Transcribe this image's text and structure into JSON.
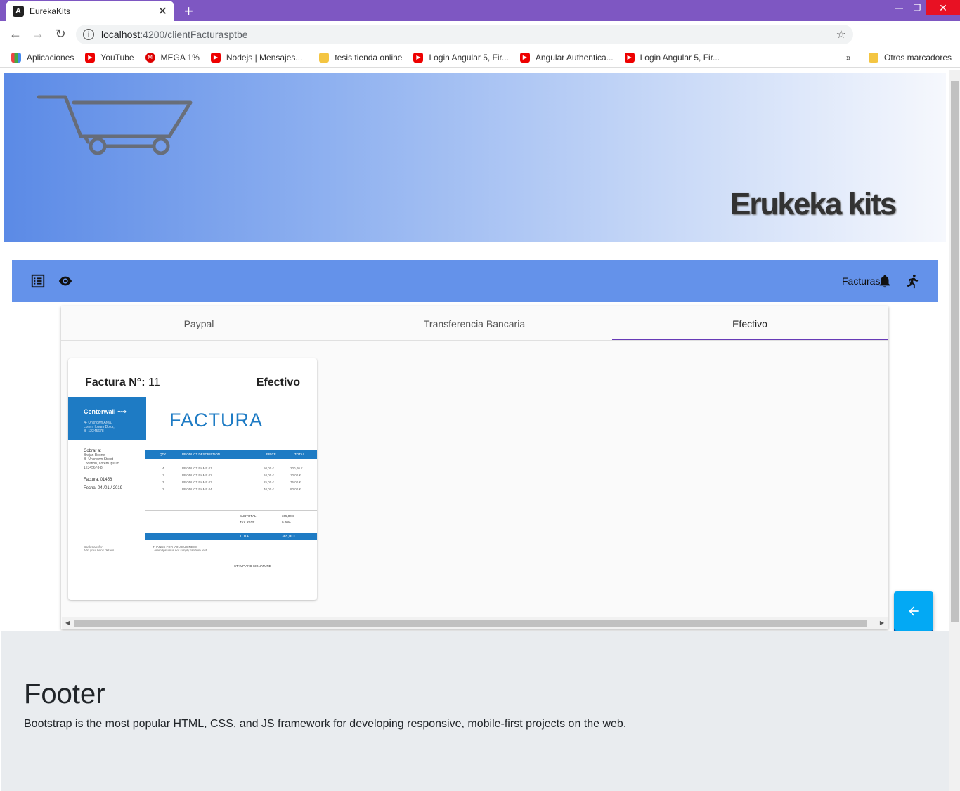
{
  "browser": {
    "tab_title": "EurekaKits",
    "tab_favicon": "A",
    "url_host": "localhost",
    "url_path": ":4200/clientFacturasptbe",
    "bookmarks": [
      {
        "label": "Aplicaciones",
        "icon": "apps-icon"
      },
      {
        "label": "YouTube",
        "icon": "youtube-icon"
      },
      {
        "label": "MEGA 1%",
        "icon": "mega-icon"
      },
      {
        "label": "Nodejs | Mensajes...",
        "icon": "youtube-icon"
      },
      {
        "label": "tesis tienda online",
        "icon": "folder-icon"
      },
      {
        "label": "Login Angular 5, Fir...",
        "icon": "youtube-icon"
      },
      {
        "label": "Angular Authentica...",
        "icon": "youtube-icon"
      },
      {
        "label": "Login Angular 5, Fir...",
        "icon": "youtube-icon"
      }
    ],
    "other_bookmarks": "Otros marcadores",
    "overflow": "»"
  },
  "banner": {
    "brand": "Erukeka kits"
  },
  "toolbar": {
    "label": "Facturas"
  },
  "tabs": [
    {
      "label": "Paypal"
    },
    {
      "label": "Transferencia Bancaria"
    },
    {
      "label": "Efectivo"
    }
  ],
  "invoice": {
    "title": "Factura N°:",
    "number": "11",
    "method": "Efectivo",
    "doc": {
      "company": "Centerwall",
      "company_address": [
        "A- Unknown Area,",
        "Lorem Ipsum Dolor,",
        "B- 12345678"
      ],
      "heading": "FACTURA",
      "bill_to_label": "Cobrar a:",
      "bill_to": [
        "Brajan Boone",
        "B- Unknown Street",
        "Location, Lorem Ipsum",
        "12345678-8"
      ],
      "invoice_no": "Factura. 01456",
      "date": "Fecha. 04 /01 / 2019",
      "columns": [
        "QTY",
        "PRODUCT DESCRIPTION",
        "PRICE",
        "TOTAL"
      ],
      "rows": [
        [
          "4",
          "PRODUCT NAME 01",
          "50,00 €",
          "200,00 €"
        ],
        [
          "1",
          "PRODUCT NAME 02",
          "10,00 €",
          "10,00 €"
        ],
        [
          "3",
          "PRODUCT NAME 03",
          "25,00 €",
          "75,00 €"
        ],
        [
          "2",
          "PRODUCT NAME 04",
          "40,00 €",
          "80,00 €"
        ]
      ],
      "subtotal_label": "SUBTOTAL",
      "subtotal": "365,00 €",
      "tax_label": "TAX RATE",
      "tax": "0.00%",
      "total_label": "TOTAL",
      "total": "365,00 €",
      "bank_transfer": [
        "Bank transfer",
        "Add your bank details"
      ],
      "thanks": [
        "THANKS FOR YOU BUSINESS",
        "Lorem Ipsum is not simply random text"
      ],
      "stamp": "STAMP AND SIGNATURE"
    }
  },
  "footer": {
    "title": "Footer",
    "text": "Bootstrap is the most popular HTML, CSS, and JS framework for developing responsive, mobile-first projects on the web."
  },
  "colors": {
    "tabstrip": "#7e57c2",
    "toolbar": "#6492ea",
    "ink": "#673ab7",
    "fab": "#03a9f4",
    "invoice_blue": "#1e7bc4"
  }
}
